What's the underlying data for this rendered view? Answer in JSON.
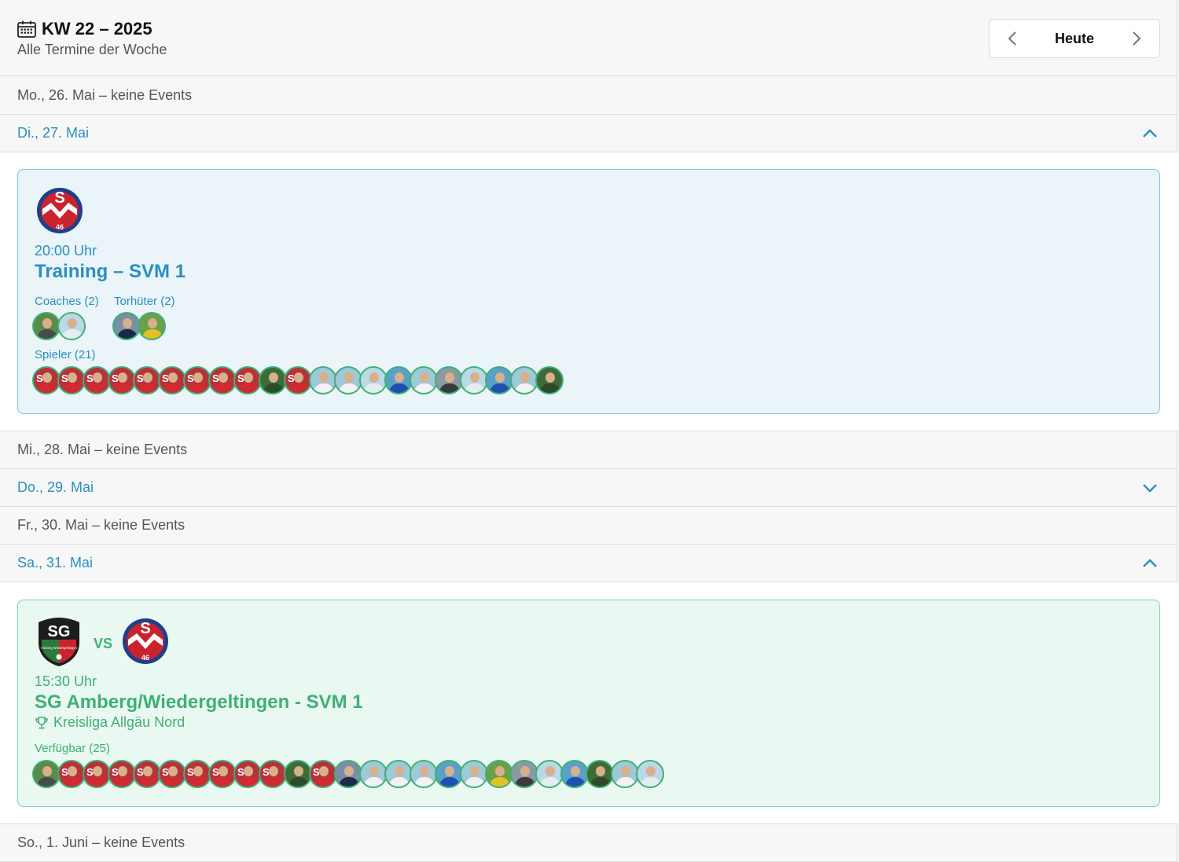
{
  "header": {
    "icon": "calendar-icon",
    "title": "KW 22 – 2025",
    "subtitle": "Alle Termine der Woche",
    "today_label": "Heute"
  },
  "days": {
    "mon": "Mo., 26. Mai – keine Events",
    "tue": "Di., 27. Mai",
    "wed": "Mi., 28. Mai – keine Events",
    "thu": "Do., 29. Mai",
    "fri": "Fr., 30. Mai – keine Events",
    "sat": "Sa., 31. Mai",
    "sun": "So., 1. Juni – keine Events"
  },
  "training": {
    "time": "20:00 Uhr",
    "title": "Training – SVM 1",
    "logo_text": "S",
    "logo_number": "46",
    "groups": {
      "coaches": "Coaches (2)",
      "goalkeepers": "Torhüter (2)",
      "players": "Spieler (21)"
    },
    "coaches": [
      "field",
      "light"
    ],
    "goalkeepers": [
      "navy",
      "yellow"
    ],
    "players": [
      "red",
      "red",
      "red",
      "red",
      "red",
      "red",
      "red",
      "red",
      "red",
      "green",
      "red",
      "white",
      "white",
      "light",
      "blue",
      "white",
      "gray",
      "light",
      "blue",
      "white",
      "green"
    ]
  },
  "match": {
    "home_logo_text": "SG",
    "home_logo_small": "Amberg Wiedergeltingen",
    "vs": "VS",
    "away_logo_text": "S",
    "away_logo_number": "46",
    "time": "15:30 Uhr",
    "title": "SG Amberg/Wiedergeltingen - SVM 1",
    "league_icon": "trophy-icon",
    "league": "Kreisliga Allgäu Nord",
    "available_label": "Verfügbar (25)",
    "available": [
      "field",
      "red",
      "red",
      "red",
      "red",
      "red",
      "red",
      "red",
      "red",
      "red",
      "green",
      "red",
      "navy",
      "white",
      "white",
      "white",
      "blue",
      "white",
      "yellow",
      "gray",
      "light",
      "blue",
      "green",
      "white",
      "light"
    ]
  },
  "colors": {
    "accent_blue": "#2b8fbf",
    "accent_green": "#3fb076",
    "card_blue_bg": "#eaf4f9",
    "card_green_bg": "#e9f8f0"
  }
}
